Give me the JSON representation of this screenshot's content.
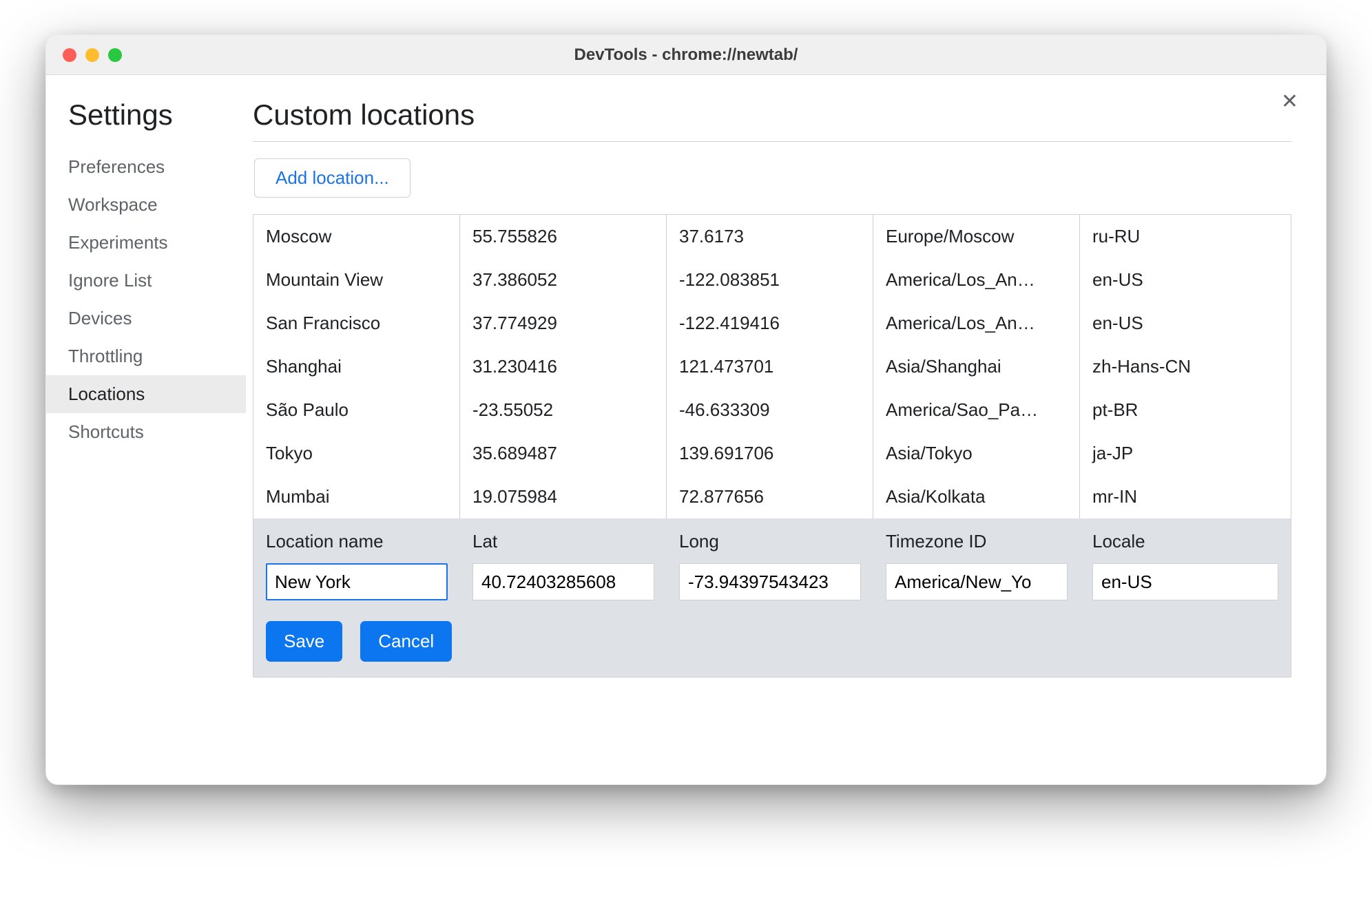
{
  "window": {
    "title": "DevTools - chrome://newtab/"
  },
  "sidebar": {
    "title": "Settings",
    "items": [
      {
        "label": "Preferences",
        "selected": false
      },
      {
        "label": "Workspace",
        "selected": false
      },
      {
        "label": "Experiments",
        "selected": false
      },
      {
        "label": "Ignore List",
        "selected": false
      },
      {
        "label": "Devices",
        "selected": false
      },
      {
        "label": "Throttling",
        "selected": false
      },
      {
        "label": "Locations",
        "selected": true
      },
      {
        "label": "Shortcuts",
        "selected": false
      }
    ]
  },
  "main": {
    "title": "Custom locations",
    "add_button_label": "Add location...",
    "close_label": "✕",
    "locations": [
      {
        "name": "Moscow",
        "lat": "55.755826",
        "long": "37.6173",
        "timezone": "Europe/Moscow",
        "locale": "ru-RU"
      },
      {
        "name": "Mountain View",
        "lat": "37.386052",
        "long": "-122.083851",
        "timezone": "America/Los_An…",
        "locale": "en-US"
      },
      {
        "name": "San Francisco",
        "lat": "37.774929",
        "long": "-122.419416",
        "timezone": "America/Los_An…",
        "locale": "en-US"
      },
      {
        "name": "Shanghai",
        "lat": "31.230416",
        "long": "121.473701",
        "timezone": "Asia/Shanghai",
        "locale": "zh-Hans-CN"
      },
      {
        "name": "São Paulo",
        "lat": "-23.55052",
        "long": "-46.633309",
        "timezone": "America/Sao_Pa…",
        "locale": "pt-BR"
      },
      {
        "name": "Tokyo",
        "lat": "35.689487",
        "long": "139.691706",
        "timezone": "Asia/Tokyo",
        "locale": "ja-JP"
      },
      {
        "name": "Mumbai",
        "lat": "19.075984",
        "long": "72.877656",
        "timezone": "Asia/Kolkata",
        "locale": "mr-IN"
      }
    ],
    "editor": {
      "headers": {
        "name": "Location name",
        "lat": "Lat",
        "long": "Long",
        "timezone": "Timezone ID",
        "locale": "Locale"
      },
      "values": {
        "name": "New York",
        "lat": "40.72403285608",
        "long": "-73.94397543423",
        "timezone": "America/New_Yo",
        "locale": "en-US"
      },
      "save_label": "Save",
      "cancel_label": "Cancel"
    }
  }
}
